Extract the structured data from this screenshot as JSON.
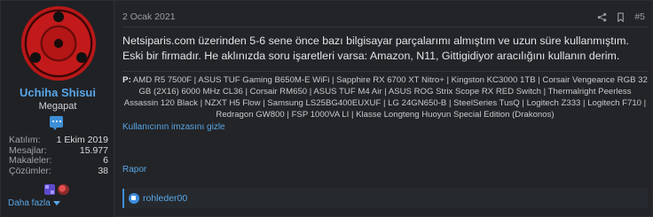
{
  "user": {
    "name": "Uchiha Shisui",
    "title": "Megapat",
    "stats": [
      {
        "label": "Katılım:",
        "value": "1 Ekim 2019"
      },
      {
        "label": "Mesajlar:",
        "value": "15.977"
      },
      {
        "label": "Makaleler:",
        "value": "6"
      },
      {
        "label": "Çözümler:",
        "value": "38"
      }
    ],
    "more_label": "Daha fazla"
  },
  "post": {
    "date": "2 Ocak 2021",
    "number": "#5",
    "body": "Netsiparis.com üzerinden 5-6 sene önce bazı bilgisayar parçalarımı almıştım ve uzun süre kullanmıştım. Eski bir firmadır. He aklınızda soru işaretleri varsa: Amazon, N11, Gittigidiyor aracılığını kullanın derim.",
    "signature_prefix": "P:",
    "signature": " AMD R5 7500F | ASUS TUF Gaming B650M-E WiFi | Sapphire RX 6700 XT Nitro+ | Kingston KC3000 1TB | Corsair Vengeance RGB 32 GB (2X16) 6000 MHz CL36 | Corsair RM650 | ASUS TUF M4 Air | ASUS ROG Strix Scope RX RED Switch | Thermalright Peerless Assassin 120 Black | NZXT H5 Flow | Samsung LS25BG400EUXUF | LG 24GN650-B | SteelSeries TusQ | Logitech Z333 | Logitech F710 | Redragon GW800 | FSP 1000VA LI | Klasse Longteng Huoyun Special Edition (Drakonos)",
    "signature_hide": "Kullanıcının imzasını gizle",
    "report": "Rapor",
    "reaction_user": "rohleder00"
  },
  "colors": {
    "accent": "#58a6e8",
    "background": "#232427"
  },
  "icons": [
    "share-icon",
    "bookmark-icon"
  ]
}
